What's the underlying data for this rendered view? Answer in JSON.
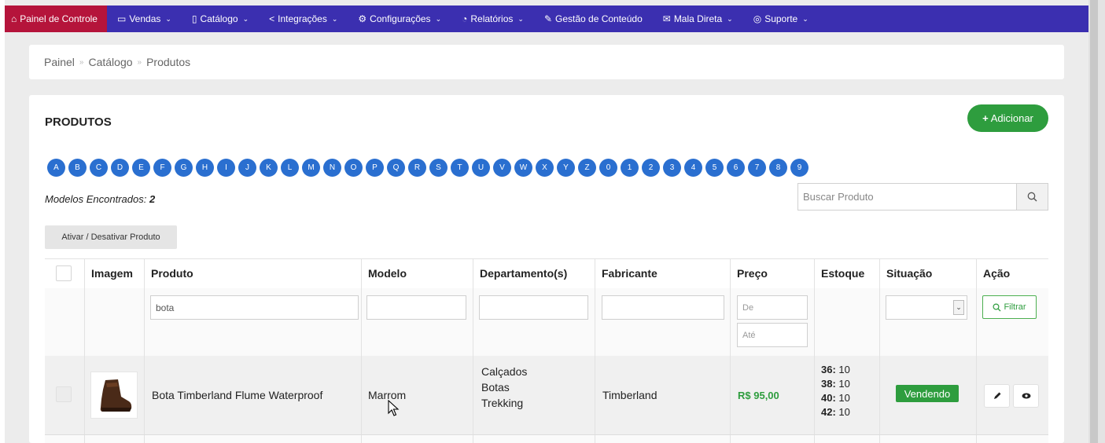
{
  "nav": {
    "items": [
      {
        "label": "Painel de Controle",
        "icon": "home-icon",
        "active": true
      },
      {
        "label": "Vendas",
        "icon": "folder-icon"
      },
      {
        "label": "Catálogo",
        "icon": "book-icon"
      },
      {
        "label": "Integrações",
        "icon": "share-icon"
      },
      {
        "label": "Configurações",
        "icon": "gear-icon"
      },
      {
        "label": "Relatórios",
        "icon": "history-icon"
      },
      {
        "label": "Gestão de Conteúdo",
        "icon": "edit-icon"
      },
      {
        "label": "Mala Direta",
        "icon": "mail-icon"
      },
      {
        "label": "Suporte",
        "icon": "lifebuoy-icon"
      }
    ]
  },
  "breadcrumb": {
    "items": [
      "Painel",
      "Catálogo",
      "Produtos"
    ]
  },
  "page": {
    "title": "PRODUTOS",
    "add_button": "Adicionar",
    "alphabet": [
      "A",
      "B",
      "C",
      "D",
      "E",
      "F",
      "G",
      "H",
      "I",
      "J",
      "K",
      "L",
      "M",
      "N",
      "O",
      "P",
      "Q",
      "R",
      "S",
      "T",
      "U",
      "V",
      "W",
      "X",
      "Y",
      "Z",
      "0",
      "1",
      "2",
      "3",
      "4",
      "5",
      "6",
      "7",
      "8",
      "9"
    ],
    "found_label": "Modelos Encontrados:",
    "found_count": "2",
    "search_placeholder": "Buscar Produto",
    "toggle_button": "Ativar / Desativar Produto"
  },
  "table": {
    "headers": {
      "image": "Imagem",
      "product": "Produto",
      "model": "Modelo",
      "departments": "Departamento(s)",
      "manufacturer": "Fabricante",
      "price": "Preço",
      "stock": "Estoque",
      "status": "Situação",
      "action": "Ação"
    },
    "filters": {
      "product_value": "bota",
      "price_from_placeholder": "De",
      "price_to_placeholder": "Até",
      "filter_button": "Filtrar"
    },
    "rows": [
      {
        "product": "Bota Timberland Flume Waterproof",
        "model": "Marrom",
        "departments": [
          "Calçados",
          "Botas",
          "Trekking"
        ],
        "manufacturer": "Timberland",
        "price": "R$ 95,00",
        "stock": [
          {
            "size": "36:",
            "qty": "10"
          },
          {
            "size": "38:",
            "qty": "10"
          },
          {
            "size": "40:",
            "qty": "10"
          },
          {
            "size": "42:",
            "qty": "10"
          }
        ],
        "status": "Vendendo"
      }
    ]
  },
  "colors": {
    "nav_bg": "#3b2fb0",
    "nav_active": "#b5143b",
    "accent_green": "#2e9d3e",
    "letter_blue": "#2a6fd0"
  }
}
